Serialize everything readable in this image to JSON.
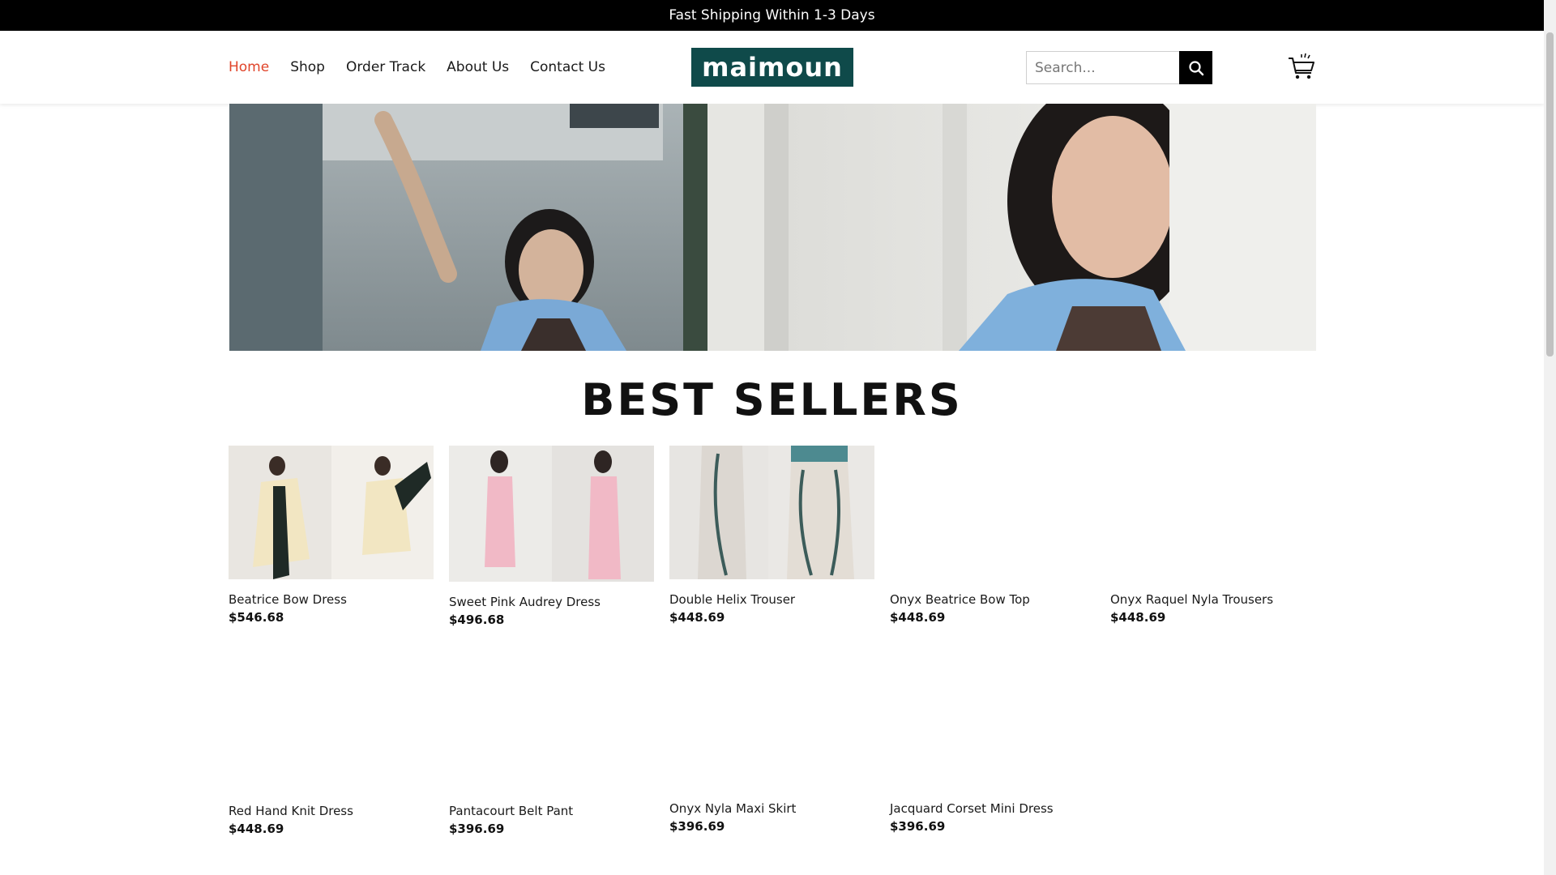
{
  "announcement": "Fast Shipping Within 1-3 Days",
  "nav": {
    "items": [
      "Home",
      "Shop",
      "Order Track",
      "About Us",
      "Contact Us"
    ],
    "active": "Home"
  },
  "logo": {
    "text": "maimoun",
    "bg_color": "#0f4a4a"
  },
  "search": {
    "placeholder": "Search...",
    "icon": "search-icon"
  },
  "cart": {
    "icon": "shopping-cart-icon"
  },
  "colors": {
    "accent": "#e0442a",
    "dark": "#000000"
  },
  "section": {
    "title": "BEST SELLERS"
  },
  "products": [
    {
      "name": "Beatrice Bow Dress",
      "price": "$546.68"
    },
    {
      "name": "Sweet Pink Audrey Dress",
      "price": "$496.68"
    },
    {
      "name": "Double Helix Trouser",
      "price": "$448.69"
    },
    {
      "name": "Onyx Beatrice Bow Top",
      "price": "$448.69"
    },
    {
      "name": "Onyx Raquel Nyla Trousers",
      "price": "$448.69"
    },
    {
      "name": "Red Hand Knit Dress",
      "price": "$448.69"
    },
    {
      "name": "Pantacourt Belt Pant",
      "price": "$396.69"
    },
    {
      "name": "Onyx Nyla Maxi Skirt",
      "price": "$396.69"
    },
    {
      "name": "Jacquard Corset Mini Dress",
      "price": "$396.69"
    }
  ]
}
